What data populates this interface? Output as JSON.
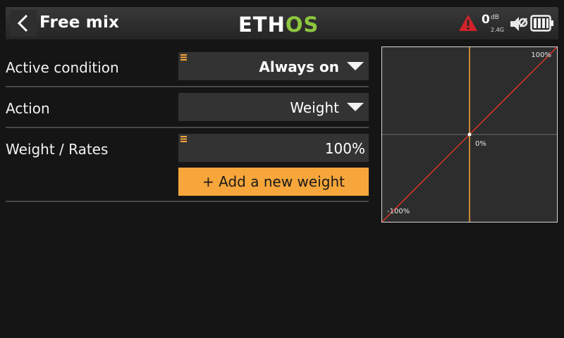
{
  "header": {
    "back_icon": "chevron-left-icon",
    "title": "Free mix",
    "logo_main": "ETH",
    "logo_accent": "OS",
    "logo_accent_color": "#8dc63f",
    "warning_icon": "warning-triangle-icon",
    "rssi_value": "0",
    "rssi_unit": "dB",
    "rssi_band": "2.4G",
    "speaker_icon": "speaker-muted-icon",
    "battery_icon": "battery-icon"
  },
  "form": {
    "active_condition": {
      "label": "Active condition",
      "value": "Always on"
    },
    "action": {
      "label": "Action",
      "value": "Weight"
    },
    "weight_rates": {
      "label": "Weight / Rates",
      "value": "100%"
    },
    "add_weight_label": "+ Add a new weight",
    "accent_color": "#f6a63a"
  },
  "graph": {
    "label_top": "100%",
    "label_center": "0%",
    "label_bottom": "-100%",
    "curve_color": "#d9352a",
    "cursor_color": "#f6a63a",
    "curve_points": [
      [
        -100,
        -100
      ],
      [
        100,
        100
      ]
    ],
    "cursor_x": 0
  }
}
